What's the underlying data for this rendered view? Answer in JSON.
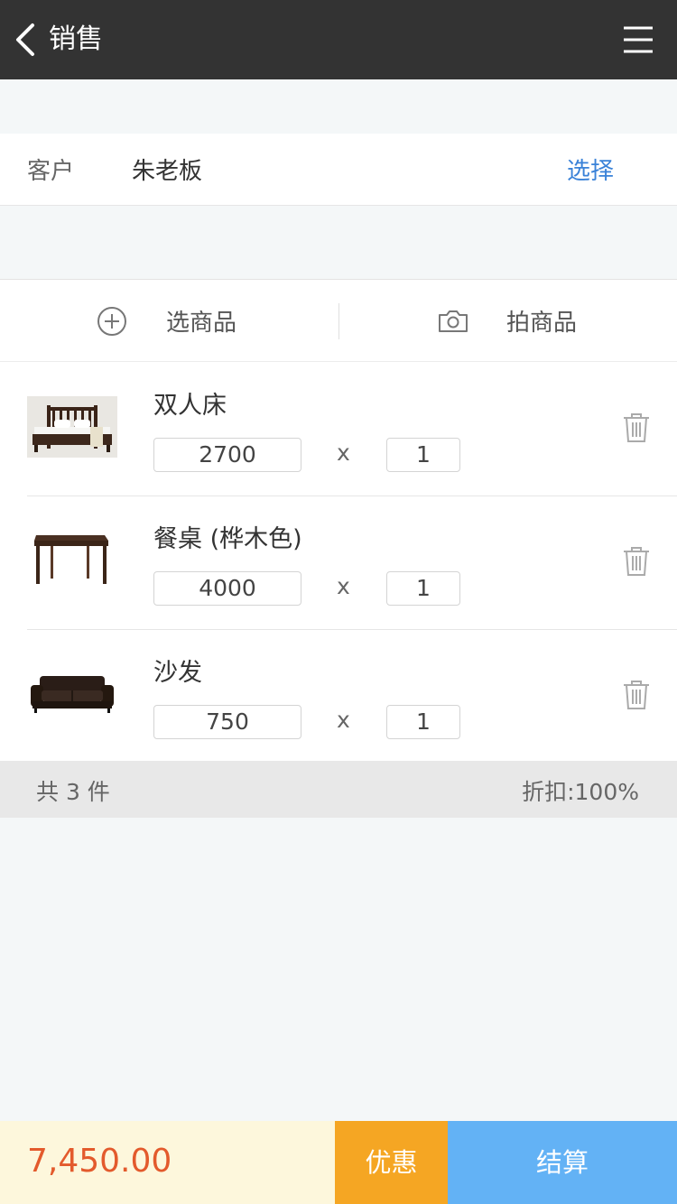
{
  "header": {
    "title": "销售",
    "back_icon": "chevron-left-icon",
    "menu_icon": "hamburger-menu-icon"
  },
  "customer": {
    "label": "客户",
    "name": "朱老板",
    "select_label": "选择"
  },
  "actions": {
    "pick_label": "选商品",
    "pick_icon": "plus-circle-icon",
    "photo_label": "拍商品",
    "photo_icon": "camera-icon"
  },
  "items": [
    {
      "name": "双人床",
      "price": "2700",
      "times": "x",
      "qty": "1",
      "image": "bed-thumbnail"
    },
    {
      "name": "餐桌 (桦木色)",
      "price": "4000",
      "times": "x",
      "qty": "1",
      "image": "dining-table-thumbnail"
    },
    {
      "name": "沙发",
      "price": "750",
      "times": "x",
      "qty": "1",
      "image": "sofa-thumbnail"
    }
  ],
  "summary": {
    "count_text": "共 3 件",
    "discount_text": "折扣:100%"
  },
  "footer": {
    "total": "7,450.00",
    "promo_label": "优惠",
    "checkout_label": "结算"
  },
  "colors": {
    "header_bg": "#333333",
    "link_blue": "#3a82d8",
    "total_red": "#e35a2c",
    "promo_orange": "#f5a623",
    "checkout_blue": "#63b2f5",
    "total_bg": "#fdf7dc"
  }
}
